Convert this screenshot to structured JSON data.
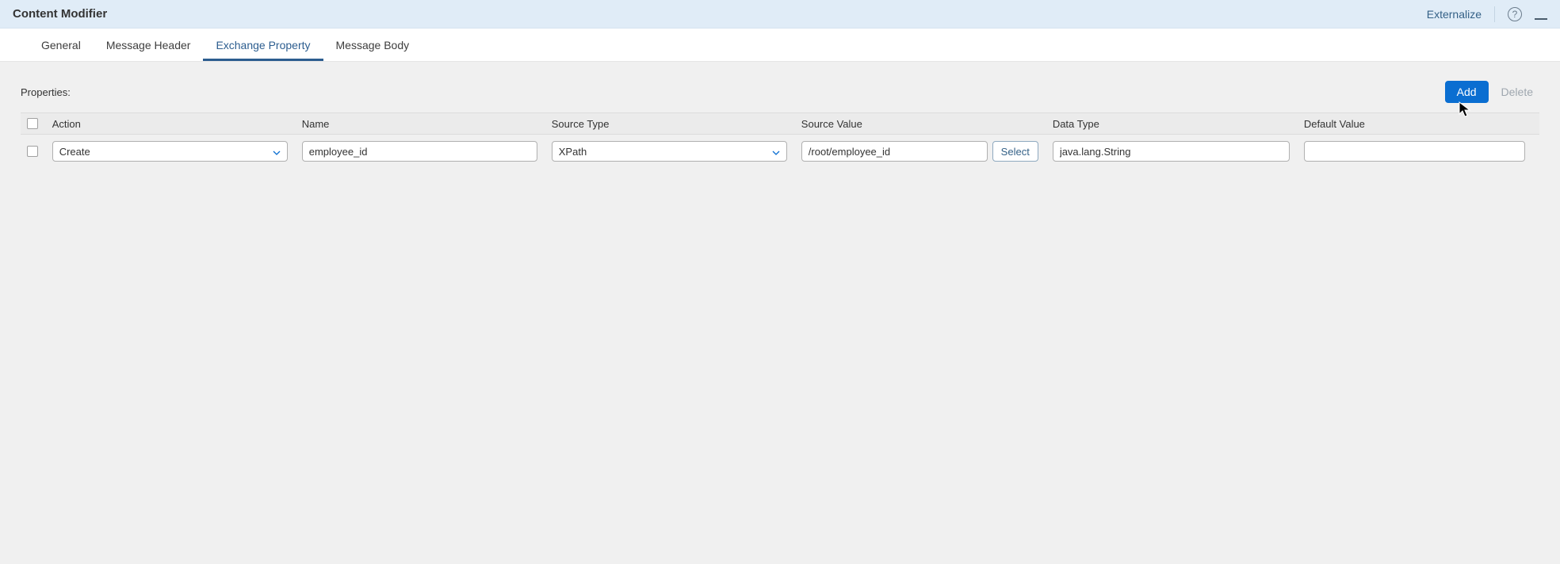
{
  "header": {
    "title": "Content Modifier",
    "externalize_label": "Externalize"
  },
  "tabs": [
    {
      "label": "General",
      "active": false
    },
    {
      "label": "Message Header",
      "active": false
    },
    {
      "label": "Exchange Property",
      "active": true
    },
    {
      "label": "Message Body",
      "active": false
    }
  ],
  "properties": {
    "label": "Properties:",
    "add_label": "Add",
    "delete_label": "Delete",
    "columns": {
      "action": "Action",
      "name": "Name",
      "source_type": "Source Type",
      "source_value": "Source Value",
      "data_type": "Data Type",
      "default_value": "Default Value"
    },
    "rows": [
      {
        "action": "Create",
        "name": "employee_id",
        "source_type": "XPath",
        "source_value": "/root/employee_id",
        "select_label": "Select",
        "data_type": "java.lang.String",
        "default_value": ""
      }
    ]
  }
}
